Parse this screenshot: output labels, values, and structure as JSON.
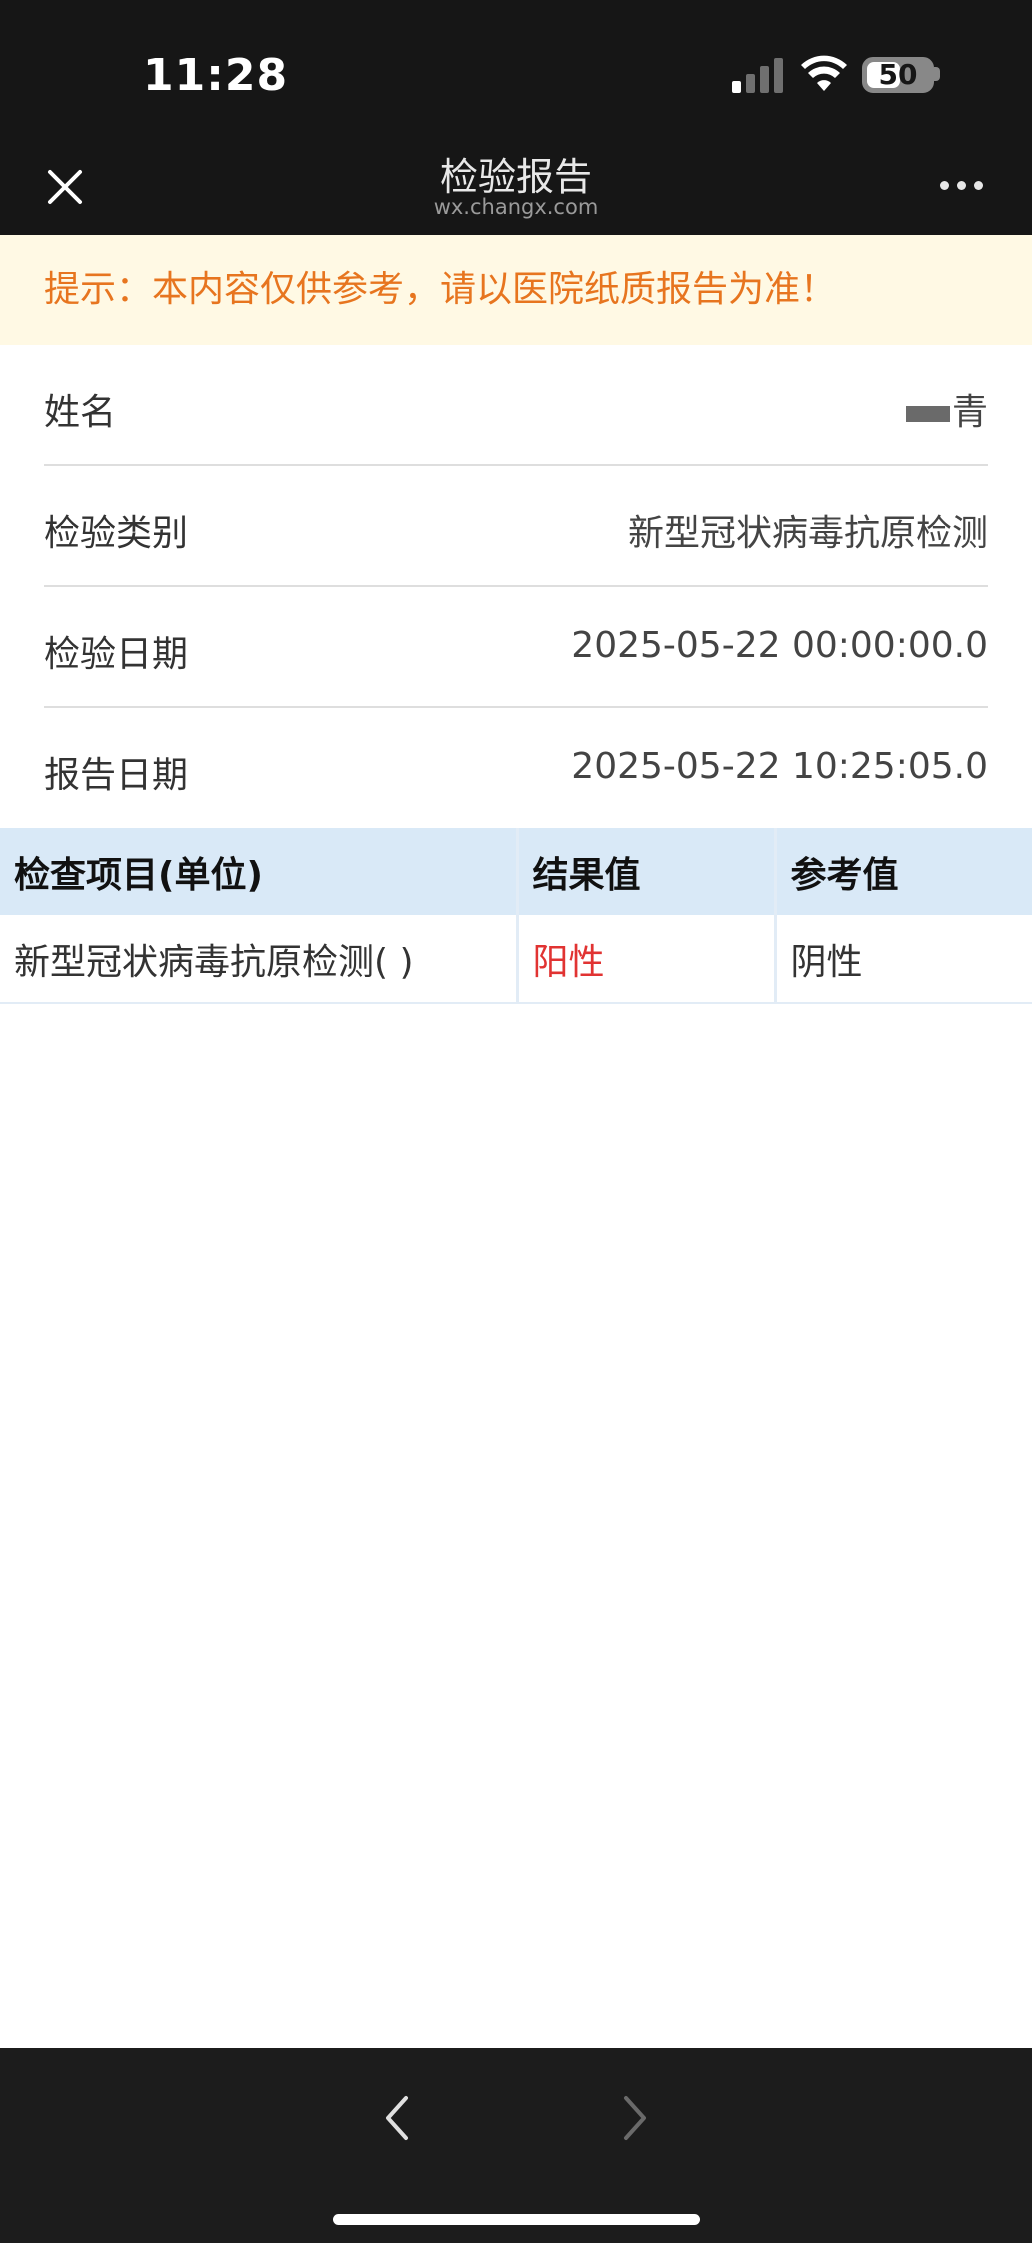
{
  "status_bar": {
    "time": "11:28",
    "battery": "50"
  },
  "nav": {
    "title": "检验报告",
    "subtitle": "wx.changx.com"
  },
  "notice": "提示：本内容仅供参考，请以医院纸质报告为准！",
  "info": [
    {
      "label": "姓名",
      "value": "青"
    },
    {
      "label": "检验类别",
      "value": "新型冠状病毒抗原检测"
    },
    {
      "label": "检验日期",
      "value": "2025-05-22 00:00:00.0"
    },
    {
      "label": "报告日期",
      "value": "2025-05-22 10:25:05.0"
    }
  ],
  "results_table": {
    "headers": [
      "检查项目(单位)",
      "结果值",
      "参考值"
    ],
    "rows": [
      {
        "item": "新型冠状病毒抗原检测( )",
        "result": "阳性",
        "reference": "阴性"
      }
    ],
    "result_abnormal_color": "#e13332"
  },
  "colors": {
    "notice_text": "#e7751f",
    "notice_bg": "#fff9e4",
    "table_header_bg": "#d9e9f7",
    "bars": "#161616"
  }
}
